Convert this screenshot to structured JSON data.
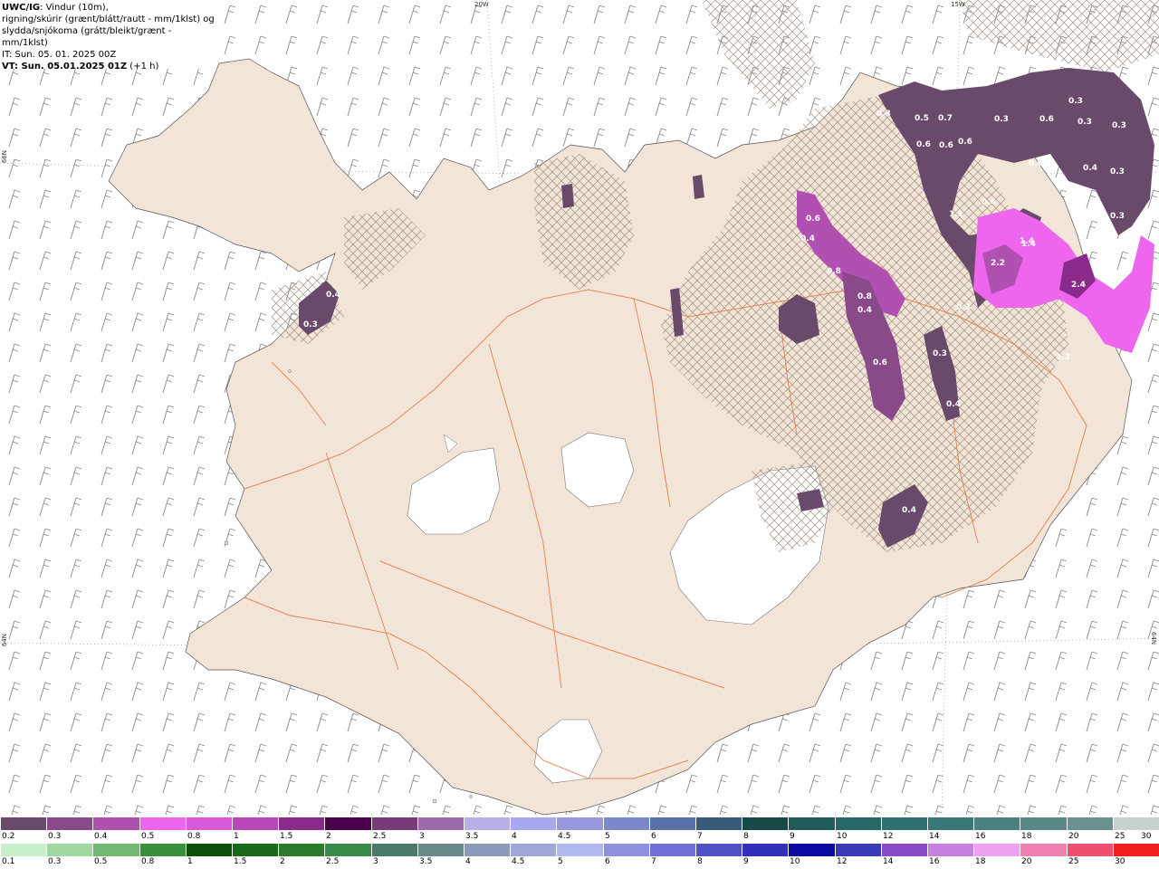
{
  "header": {
    "model": "UWC/IG",
    "line1_rest": ": Vindur (10m),",
    "line2": "rigning/skúrir (grænt/blátt/rautt - mm/1klst) og",
    "line3": "slydda/snjókoma (grátt/bleikt/grænt - mm/1klst)",
    "line4": "IT: Sun. 05. 01. 2025 00Z",
    "line5_bold": "VT: Sun. 05.01.2025 01Z",
    "line5_rest": " (+1 h)"
  },
  "grid_labels": {
    "top_20w": "20W",
    "top_15w": "15W",
    "left_66n": "66N",
    "left_64n": "64N",
    "right_64n": "64N"
  },
  "map_values": [
    "0.3",
    "0.3",
    "0.6",
    "0.3",
    "0.3",
    "0.3",
    "0.5",
    "0.7",
    "0.6",
    "0.6",
    "0.6",
    "0.4",
    "0.3",
    "0.6",
    "0.4",
    "1.1",
    "1.4",
    "0.3",
    "0.6",
    "1.4",
    "1.4",
    "2.2",
    "2.4",
    "0.3",
    "0.6",
    "0.4",
    "0.8",
    "0.8",
    "0.4",
    "0.3",
    "0.6",
    "0.4",
    "0.3",
    "0.3",
    "0.4",
    "0.4"
  ],
  "legend": {
    "snow_labels": [
      "0.2",
      "0.3",
      "0.4",
      "0.5",
      "0.8",
      "1",
      "1.5",
      "2",
      "2.5",
      "3",
      "3.5",
      "4",
      "4.5",
      "5",
      "6",
      "7",
      "8",
      "9",
      "10",
      "12",
      "14",
      "16",
      "18",
      "20",
      "25",
      "30"
    ],
    "snow_colors": [
      "#6a4a6a",
      "#8a4a8a",
      "#b050b0",
      "#ee66ee",
      "#d858d8",
      "#b848b8",
      "#8a2a8a",
      "#4a004a",
      "#7a3a7a",
      "#9a6aaa",
      "#b8b0e8",
      "#a8a8f0",
      "#9898e0",
      "#7a88cc",
      "#5a70a8",
      "#3a5a7a",
      "#184848",
      "#205a5a",
      "#286868",
      "#307070",
      "#3a7878",
      "#4a8080",
      "#5a8888",
      "#6a9090",
      "#c8d0d0"
    ],
    "rain_labels": [
      "0.1",
      "0.3",
      "0.5",
      "0.8",
      "1",
      "1.5",
      "2",
      "2.5",
      "3",
      "3.5",
      "4",
      "4.5",
      "5",
      "6",
      "7",
      "8",
      "9",
      "10",
      "12",
      "14",
      "16",
      "18",
      "20",
      "25",
      "30"
    ],
    "rain_colors": [
      "#c8f0c8",
      "#a0d8a0",
      "#70b870",
      "#3a903a",
      "#0a500a",
      "#186a18",
      "#2a7a2a",
      "#3a8a4a",
      "#4a7a6a",
      "#6a8a8a",
      "#8a9ab8",
      "#a0a8d8",
      "#b0b8f0",
      "#9090e0",
      "#7070d8",
      "#5050c8",
      "#3030b8",
      "#0a0aa0",
      "#3a3ab8",
      "#8a4ac8",
      "#c880e0",
      "#f0a0f0",
      "#f080b0",
      "#f05070",
      "#f02020"
    ]
  }
}
